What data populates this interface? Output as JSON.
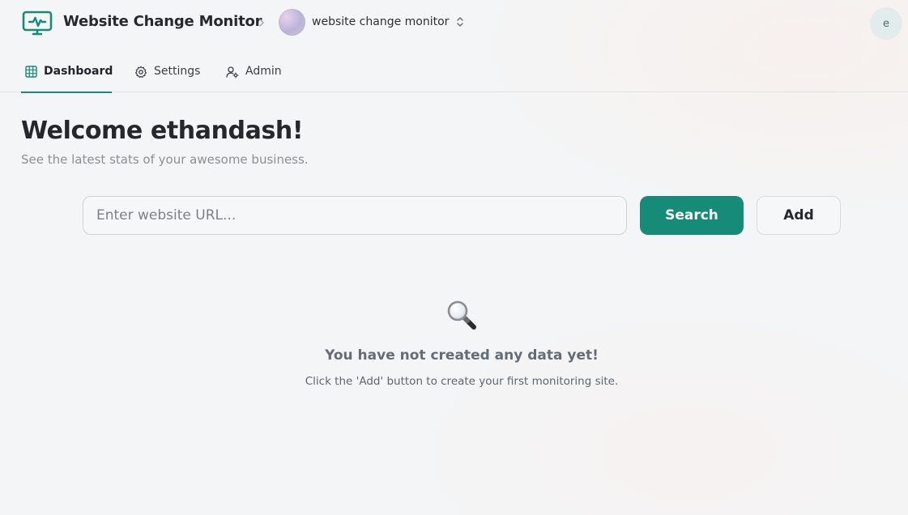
{
  "header": {
    "app_title": "Website Change Monitor",
    "logo_icon": "monitor-activity-icon",
    "breadcrumb_separator": "›",
    "workspace_name": "website change monitor",
    "workspace_switch_icon": "chevron-up-down-icon",
    "user_initial": "e"
  },
  "tabs": [
    {
      "label": "Dashboard",
      "icon": "grid-icon",
      "active": true
    },
    {
      "label": "Settings",
      "icon": "gear-icon",
      "active": false
    },
    {
      "label": "Admin",
      "icon": "user-admin-icon",
      "active": false
    }
  ],
  "main": {
    "welcome": "Welcome ethandash!",
    "subtitle": "See the latest stats of your awesome business.",
    "search_placeholder": "Enter website URL...",
    "search_button": "Search",
    "add_button": "Add"
  },
  "empty_state": {
    "icon": "magnifying-glass-icon",
    "title": "You have not created any data yet!",
    "description": "Click the 'Add' button to create your first monitoring site."
  },
  "colors": {
    "accent": "#168b77",
    "background": "#f4f5f6"
  }
}
